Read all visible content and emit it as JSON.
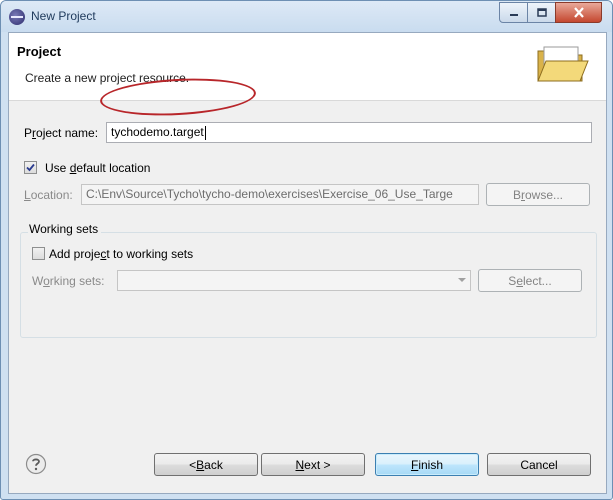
{
  "window": {
    "title": "New Project"
  },
  "header": {
    "title": "Project",
    "description": "Create a new project resource."
  },
  "project_name": {
    "label_pre": "P",
    "label_mn": "r",
    "label_post": "oject name:",
    "value": "tychodemo.target"
  },
  "use_default": {
    "label_pre": "Use ",
    "label_mn": "d",
    "label_post": "efault location",
    "checked": true
  },
  "location": {
    "label_pre": "",
    "label_mn": "L",
    "label_post": "ocation:",
    "value": "C:\\Env\\Source\\Tycho\\tycho-demo\\exercises\\Exercise_06_Use_Targe",
    "browse_pre": "B",
    "browse_mn": "r",
    "browse_post": "owse..."
  },
  "working_sets": {
    "group_title": "Working sets",
    "add_pre": "Add proje",
    "add_mn": "c",
    "add_post": "t to working sets",
    "add_checked": false,
    "label_pre": "W",
    "label_mn": "o",
    "label_post": "rking sets:",
    "value": "",
    "select_pre": "S",
    "select_mn": "e",
    "select_post": "lect..."
  },
  "buttons": {
    "back_pre": "< ",
    "back_mn": "B",
    "back_post": "ack",
    "next_pre": "",
    "next_mn": "N",
    "next_post": "ext >",
    "finish_pre": "",
    "finish_mn": "F",
    "finish_post": "inish",
    "cancel": "Cancel"
  },
  "icons": {
    "app": "eclipse-icon",
    "header": "open-folder-icon",
    "help": "help-icon"
  }
}
